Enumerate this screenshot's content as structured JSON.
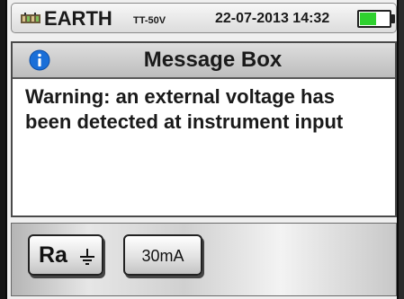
{
  "status_bar": {
    "app_name": "EARTH",
    "mode": "TT-50V",
    "datetime": "22-07-2013 14:32",
    "app_icon": "meter-icon",
    "battery_level": 0.55,
    "battery_color": "#2fd12f"
  },
  "message_box": {
    "icon": "info-icon",
    "title": "Message Box",
    "line1": "Warning: an external voltage has",
    "line2": "been detected at instrument input"
  },
  "softkeys": {
    "ra_label": "Ra",
    "ra_icon": "ground-icon",
    "current_label": "30mA"
  },
  "colors": {
    "info_blue": "#1a6fd8",
    "battery_green": "#2fd12f"
  }
}
